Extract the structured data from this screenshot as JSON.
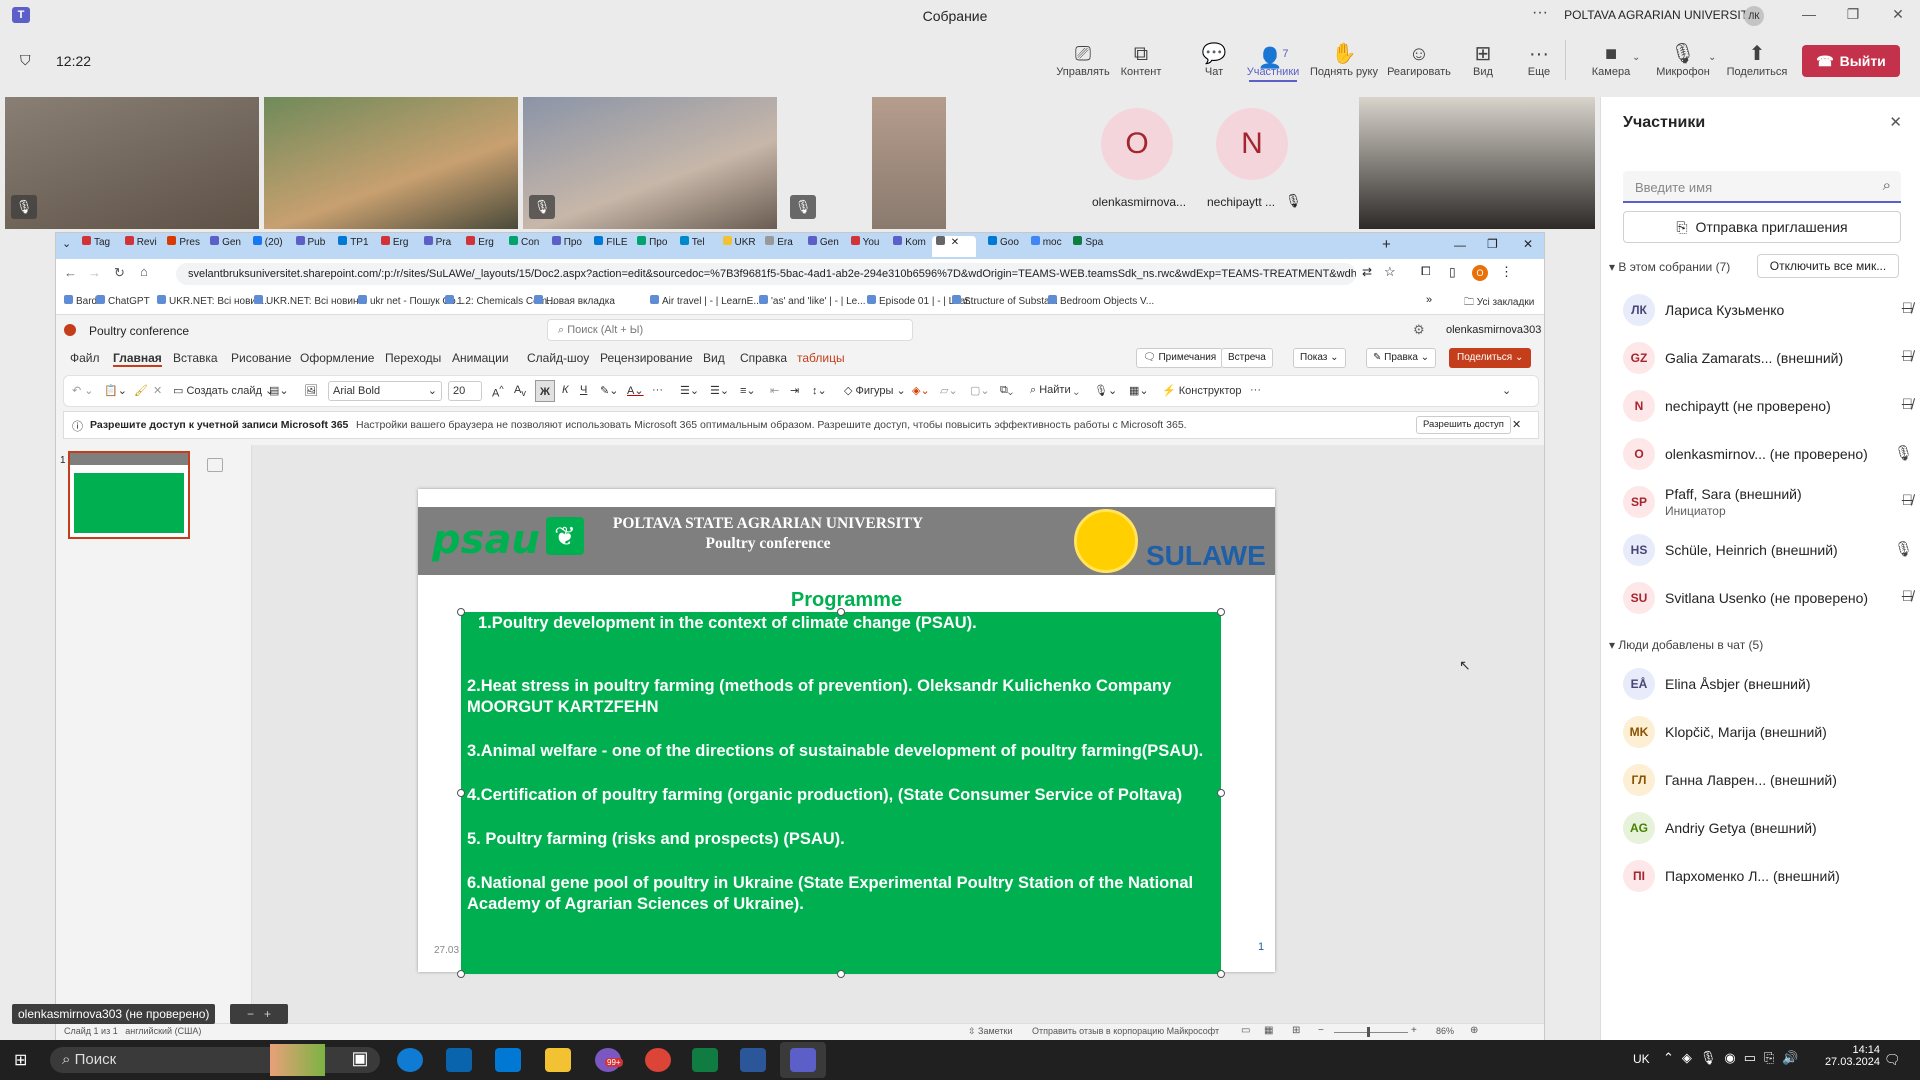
{
  "window": {
    "title": "Собрание",
    "org": "POLTAVA AGRARIAN UNIVERSITY",
    "org_initials": "ЛК"
  },
  "meeting": {
    "timer": "12:22",
    "buttons": [
      {
        "name": "control",
        "label": "Управлять",
        "icon": "present-control-icon"
      },
      {
        "name": "content",
        "label": "Контент",
        "icon": "share-content-icon"
      },
      {
        "name": "chat",
        "label": "Чат",
        "icon": "chat-icon"
      },
      {
        "name": "participants",
        "label": "Участники",
        "icon": "people-icon",
        "badge": "7"
      },
      {
        "name": "raise-hand",
        "label": "Поднять руку",
        "icon": "hand-icon"
      },
      {
        "name": "react",
        "label": "Реагировать",
        "icon": "emoji-icon"
      },
      {
        "name": "view",
        "label": "Вид",
        "icon": "grid-icon"
      },
      {
        "name": "more",
        "label": "Еще",
        "icon": "more-icon"
      },
      {
        "name": "camera",
        "label": "Камера",
        "icon": "camera-icon"
      },
      {
        "name": "mic",
        "label": "Микрофон",
        "icon": "mic-off-icon"
      },
      {
        "name": "share",
        "label": "Поделиться",
        "icon": "share-icon"
      }
    ],
    "leave_label": "Выйти"
  },
  "videos": [
    {
      "initial": "O",
      "name": "olenkasmirnova..."
    },
    {
      "initial": "N",
      "name": "nechipaytt ..."
    }
  ],
  "browser": {
    "tabs": [
      "Tag",
      "Revi",
      "Pres",
      "Gen",
      "(20)",
      "Pub",
      "TP1",
      "Erg",
      "Pra",
      "Erg",
      "Con",
      "Про",
      "FILE",
      "Про",
      "Tel",
      "UKR",
      "Era",
      "Gen",
      "You",
      "Kom",
      "",
      "Goo",
      "moc",
      "Spa"
    ],
    "url": "svelantbruksuniversitet.sharepoint.com/:p:/r/sites/SuLAWe/_layouts/15/Doc2.aspx?action=edit&sourcedoc=%7B3f9681f5-5bac-4ad1-ab2e-294e310b6596%7D&wdOrigin=TEAMS-WEB.teamsSdk_ns.rwc&wdExp=TEAMS-TREATMENT&wdho...",
    "bookmarks": [
      "Bard",
      "ChatGPT",
      "UKR.NET: Всі новин...",
      "UKR.NET: Всі новин...",
      "ukr net - Пошук Go...",
      "1.2: Chemicals Com...",
      "Новая вкладка",
      "Air travel | - | LearnE...",
      "'as' and 'like' | - | Le...",
      "Episode 01 | - | Lear...",
      "Structure of Substa...",
      "Bedroom Objects V..."
    ],
    "bookmarks_folder": "Усі закладки"
  },
  "ppt": {
    "doc_name": "Poultry conference",
    "search_placeholder": "Поиск (Alt + Ы)",
    "user": "olenkasmirnova303",
    "menus": [
      "Файл",
      "Главная",
      "Вставка",
      "Рисование",
      "Оформление",
      "Переходы",
      "Анимации",
      "Слайд-шоу",
      "Рецензирование",
      "Вид",
      "Справка",
      "таблицы"
    ],
    "right_buttons": [
      "Примечания",
      "Встреча",
      "Показ",
      "Правка",
      "Поделиться"
    ],
    "ribbon": {
      "new_slide": "Создать слайд",
      "font": "Arial Bold",
      "size": "20",
      "shapes": "Фигуры",
      "find": "Найти",
      "designer": "Конструктор"
    },
    "notice_bold": "Разрешите доступ к учетной записи Microsoft 365",
    "notice_text": "Настройки вашего браузера не позволяют использовать Microsoft 365 оптимальным образом. Разрешите доступ, чтобы повысить эффективность работы с Microsoft 365.",
    "notice_button": "Разрешить доступ",
    "thumb_number": "1",
    "status": {
      "slide": "Слайд 1 из 1",
      "lang": "английский (США)",
      "notes": "Заметки",
      "feedback": "Отправить отзыв в корпорацию Майкрософт",
      "zoom": "86%"
    }
  },
  "slide": {
    "logo_left": "psau",
    "university": "POLTAVA STATE AGRARIAN UNIVERSITY",
    "conference": "Poultry conference",
    "logo_right": "SULAWE",
    "heading": "Programme",
    "items": [
      "1.Poultry development in the context of climate change (PSAU).",
      "2.Heat stress in poultry farming (methods of prevention). Oleksandr Kulichenko Company MOORGUT KARTZFEHN",
      "3.Animal welfare - one of the directions of sustainable development of poultry farming(PSAU).",
      "4.Certification of poultry farming (organic production), (State Consumer Service of Poltava)",
      "5. Poultry farming (risks and prospects) (PSAU).",
      "6.National gene pool of poultry in Ukraine (State Experimental Poultry Station of the National Academy of Agrarian Sciences of Ukraine)."
    ],
    "date": "27.03",
    "page": "1"
  },
  "share_label": "olenkasmirnova303 (не проверено)",
  "panel": {
    "title": "Участники",
    "search_placeholder": "Введите имя",
    "invite_label": "Отправка приглашения",
    "in_meeting_label": "В этом собрании (7)",
    "mute_all_label": "Отключить все мик...",
    "in_meeting": [
      {
        "initials": "ЛК",
        "name": "Лариса Кузьменко",
        "mic": "muted",
        "bg": "#e8ebfa",
        "fg": "#464775"
      },
      {
        "initials": "GZ",
        "name": "Galia Zamarats... (внешний)",
        "mic": "muted",
        "bg": "#fde7e9",
        "fg": "#a4262c"
      },
      {
        "initials": "N",
        "name": "nechipaytt (не проверено)",
        "mic": "muted",
        "bg": "#fde7e9",
        "fg": "#a4262c"
      },
      {
        "initials": "O",
        "name": "olenkasmirnov... (не проверено)",
        "mic": "on",
        "bg": "#fde7e9",
        "fg": "#a4262c"
      },
      {
        "initials": "SP",
        "name": "Pfaff, Sara (внешний)",
        "sub": "Инициатор",
        "mic": "muted",
        "bg": "#fde7e9",
        "fg": "#a4262c"
      },
      {
        "initials": "HS",
        "name": "Schüle, Heinrich (внешний)",
        "mic": "on",
        "bg": "#e8ebfa",
        "fg": "#464775"
      },
      {
        "initials": "SU",
        "name": "Svitlana Usenko (не проверено)",
        "mic": "muted",
        "bg": "#fde7e9",
        "fg": "#a4262c"
      }
    ],
    "chat_label": "Люди добавлены в чат (5)",
    "in_chat": [
      {
        "initials": "EÅ",
        "name": "Elina Åsbjer (внешний)",
        "bg": "#e8ebfa",
        "fg": "#464775"
      },
      {
        "initials": "MK",
        "name": "Klopčič, Marija (внешний)",
        "bg": "#fcefd3",
        "fg": "#8a5100"
      },
      {
        "initials": "ГЛ",
        "name": "Ганна Лаврен... (внешний)",
        "bg": "#fcefd3",
        "fg": "#8a5100"
      },
      {
        "initials": "AG",
        "name": "Andriy Getya (внешний)",
        "bg": "#e7f2da",
        "fg": "#498205"
      },
      {
        "initials": "ПІ",
        "name": "Пархоменко Л... (внешний)",
        "bg": "#fde7e9",
        "fg": "#a4262c"
      }
    ]
  },
  "taskbar": {
    "search": "Поиск",
    "lang": "UK",
    "time": "14:14",
    "date": "27.03.2024",
    "badge": "99+"
  }
}
